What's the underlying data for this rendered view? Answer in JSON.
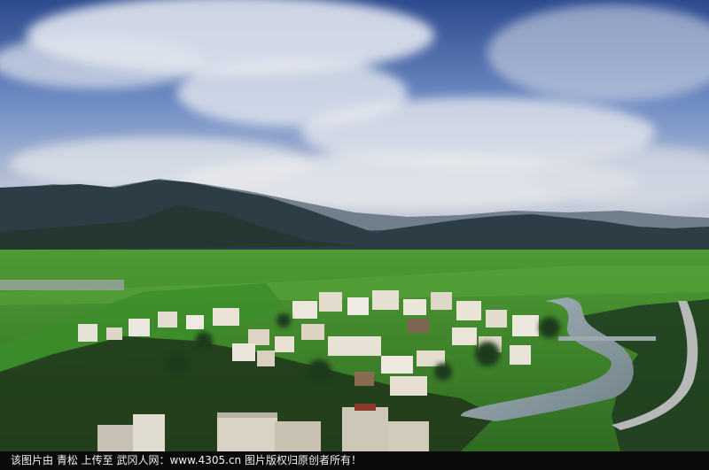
{
  "photo": {
    "subject": "mountain-valley-village-landscape"
  },
  "caption": {
    "text": "该图片由 青松 上传至 武冈人网：www.4305.cn 图片版权归原创者所有！"
  },
  "colors": {
    "sky_top": "#2f4f93",
    "sky_mid": "#7d97c8",
    "cloud": "#e6e9f0",
    "mountain": "#2b3a43",
    "field": "#3f8a2c",
    "river": "#8da0a8",
    "caption_bg": "#0a0a0a"
  }
}
